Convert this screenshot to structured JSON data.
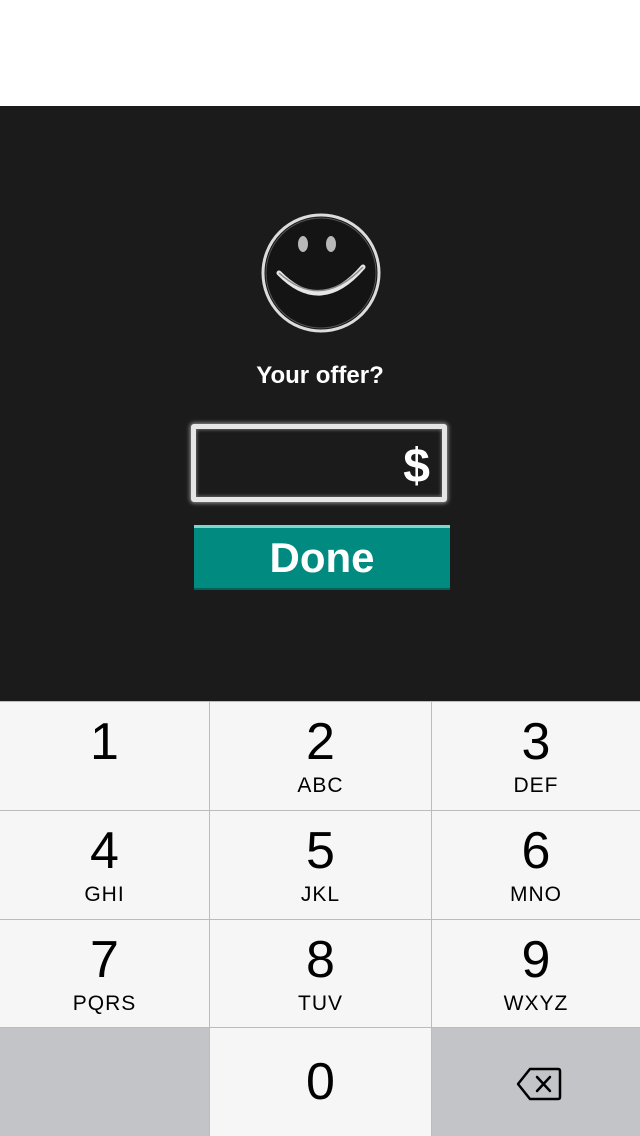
{
  "offer": {
    "prompt": "Your offer?",
    "currency_symbol": "$",
    "amount_value": "",
    "done_label": "Done"
  },
  "keypad": {
    "keys": [
      {
        "digit": "1",
        "letters": ""
      },
      {
        "digit": "2",
        "letters": "ABC"
      },
      {
        "digit": "3",
        "letters": "DEF"
      },
      {
        "digit": "4",
        "letters": "GHI"
      },
      {
        "digit": "5",
        "letters": "JKL"
      },
      {
        "digit": "6",
        "letters": "MNO"
      },
      {
        "digit": "7",
        "letters": "PQRS"
      },
      {
        "digit": "8",
        "letters": "TUV"
      },
      {
        "digit": "9",
        "letters": "WXYZ"
      },
      {
        "digit": "0",
        "letters": ""
      }
    ],
    "delete_icon": "backspace-icon"
  },
  "icons": {
    "header_icon": "smiley-face-icon"
  },
  "colors": {
    "panel_background": "#1b1b1b",
    "done_button": "#008a80",
    "key_background": "#f6f6f6",
    "key_dark_background": "#c3c4c8"
  }
}
